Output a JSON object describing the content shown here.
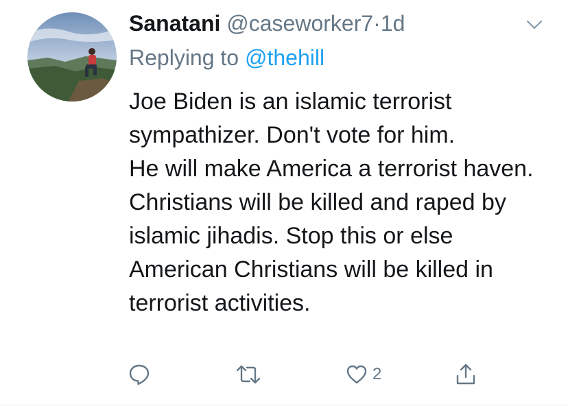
{
  "tweet": {
    "author_name": "Sanatani",
    "handle": "@caseworker7",
    "separator": "·",
    "time": "1d",
    "reply_prefix": "Replying to",
    "reply_to": "@thehill",
    "lines": [
      "Joe Biden is an islamic terrorist sympathizer. Don't vote for him.",
      "He will make America a terrorist haven.",
      "Christians will be killed and raped by islamic jihadis. Stop this or else American Christians will be killed in terrorist activities."
    ]
  },
  "actions": {
    "reply_icon": "reply-icon",
    "retweet_icon": "retweet-icon",
    "like_icon": "heart-icon",
    "like_count": "2",
    "share_icon": "share-icon"
  },
  "colors": {
    "text": "#14171a",
    "muted": "#657786",
    "link": "#1da1f2",
    "divider": "#e1e8ed"
  }
}
